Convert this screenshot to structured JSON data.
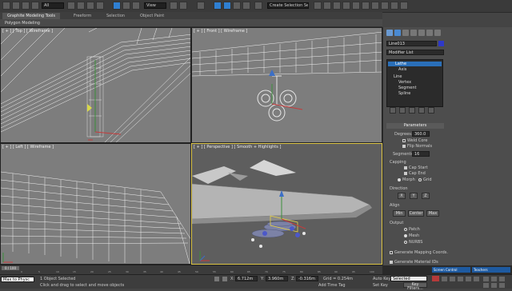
{
  "toolbar": {
    "selection_filter": "All",
    "view_dropdown": "View",
    "named_selection": "Create Selection Se"
  },
  "ribbon": {
    "tabs": [
      "Graphite Modeling Tools",
      "Freeform",
      "Selection",
      "Object Paint"
    ],
    "row_label": "Polygon Modeling"
  },
  "viewports": {
    "top_label": "[ + ] [ Top ] [ Wireframe ]",
    "front_label": "[ + ] [ Front ] [ Wireframe ]",
    "left_label": "[ + ] [ Left ] [ Wireframe ]",
    "persp_label": "[ + ] [ Perspective ] [ Smooth + Highlights ]"
  },
  "command_panel": {
    "object_name": "Line013",
    "modifier_list": "Modifier List",
    "stack": [
      "Lathe",
      "Axis",
      "Line",
      "Vertex",
      "Segment",
      "Spline"
    ],
    "params_title": "Parameters",
    "degrees_label": "Degrees:",
    "degrees_value": "360.0",
    "weld_core": "Weld Core",
    "flip_normals": "Flip Normals",
    "segments_label": "Segments:",
    "segments_value": "16",
    "capping_title": "Capping",
    "cap_start": "Cap Start",
    "cap_end": "Cap End",
    "morph": "Morph",
    "grid": "Grid",
    "direction_title": "Direction",
    "dir_x": "X",
    "dir_y": "Y",
    "dir_z": "Z",
    "align_title": "Align",
    "align_min": "Min",
    "align_center": "Center",
    "align_max": "Max",
    "output_title": "Output",
    "out_patch": "Patch",
    "out_mesh": "Mesh",
    "out_nurbs": "NURBS",
    "gen_mapping": "Generate Mapping Coords.",
    "gen_material": "Generate Material IDs"
  },
  "timeline": {
    "frame": "0 / 100",
    "ticks": [
      "0",
      "5",
      "10",
      "15",
      "20",
      "25",
      "30",
      "35",
      "40",
      "45",
      "50",
      "55",
      "60",
      "65",
      "70",
      "75",
      "80",
      "85",
      "90",
      "95",
      "100"
    ]
  },
  "status": {
    "maxscript": "Max to Physc",
    "selected": "1 Object Selected",
    "prompt": "Click and drag to select and move objects",
    "x_label": "X:",
    "x_value": "6.712m",
    "y_label": "Y:",
    "y_value": "3.960m",
    "z_label": "Z:",
    "z_value": "-0.316m",
    "grid": "Grid = 0.254m",
    "auto_key": "Auto Key",
    "selected_dd": "Selected",
    "set_key": "Set Key",
    "key_filters": "Key Filters...",
    "add_time_tag": "Add Time Tag"
  },
  "taskbar": {
    "item1": "Screen Control",
    "item2": "Teachers"
  }
}
